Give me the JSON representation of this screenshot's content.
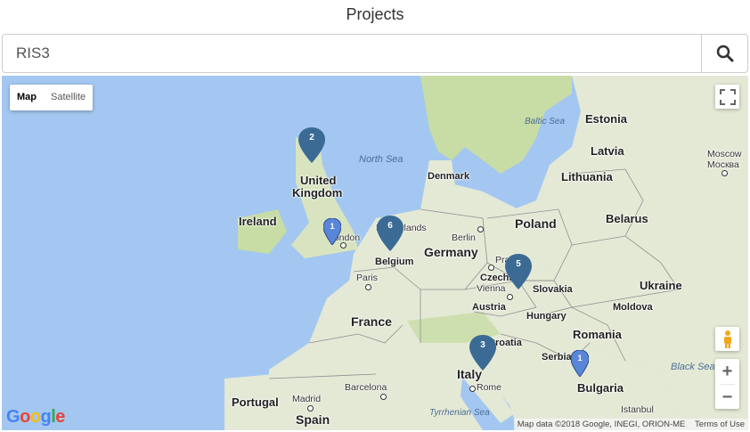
{
  "header": {
    "title": "Projects"
  },
  "search": {
    "value": "RIS3",
    "button_icon": "search-icon"
  },
  "map": {
    "type_control": {
      "map_label": "Map",
      "satellite_label": "Satellite",
      "active": "Map"
    },
    "markers": [
      {
        "count": "2",
        "color": "#3b6b94"
      },
      {
        "count": "1",
        "color": "#5a86d8"
      },
      {
        "count": "6",
        "color": "#3b6b94"
      },
      {
        "count": "5",
        "color": "#3b6b94"
      },
      {
        "count": "3",
        "color": "#3b6b94"
      },
      {
        "count": "1",
        "color": "#5a86d8"
      }
    ],
    "labels": {
      "baltic_sea": "Baltic Sea",
      "north_sea": "North Sea",
      "estonia": "Estonia",
      "latvia": "Latvia",
      "lithuania": "Lithuania",
      "moscow": "Moscow",
      "moscow_ru": "Москва",
      "united_kingdom_1": "United",
      "united_kingdom_2": "Kingdom",
      "denmark": "Denmark",
      "ireland": "Ireland",
      "london": "London",
      "netherlands": "Netherlands",
      "berlin": "Berlin",
      "poland": "Poland",
      "belarus": "Belarus",
      "belgium": "Belgium",
      "germany": "Germany",
      "prague": "Prague",
      "czechia": "Czechia",
      "paris": "Paris",
      "vienna": "Vienna",
      "slovakia": "Slovakia",
      "ukraine": "Ukraine",
      "austria": "Austria",
      "hungary": "Hungary",
      "moldova": "Moldova",
      "france": "France",
      "croatia": "Croatia",
      "romania": "Romania",
      "serbia": "Serbia",
      "black_sea": "Black Sea",
      "italy": "Italy",
      "bulgaria": "Bulgaria",
      "portugal": "Portugal",
      "madrid": "Madrid",
      "barcelona": "Barcelona",
      "rome": "Rome",
      "tyrrhenian_sea": "Tyrrhenian Sea",
      "istanbul": "Istanbul",
      "spain": "Spain"
    },
    "attribution": "Map data ©2018 Google, INEGI, ORION-ME",
    "terms": "Terms of Use",
    "logo": "Google",
    "colors": {
      "land": "#e4e9d6",
      "water": "#a3c7f0",
      "land_green": "#c8dca5",
      "border": "#8f8f8f"
    }
  }
}
